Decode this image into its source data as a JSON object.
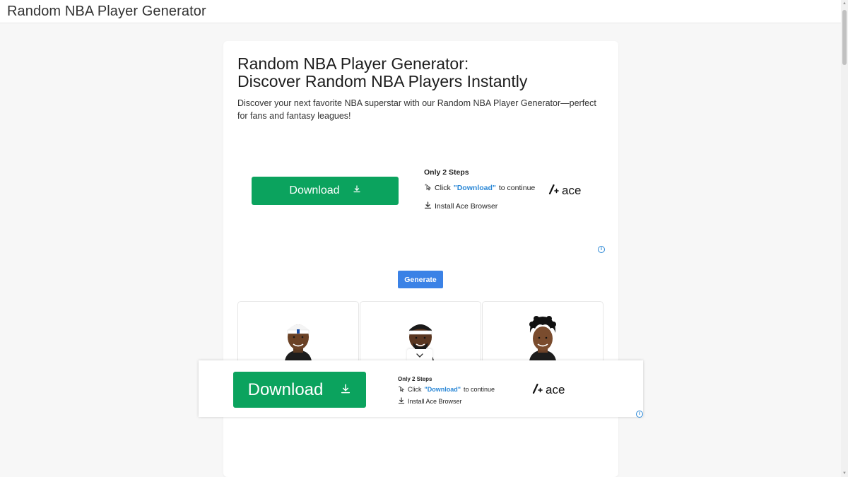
{
  "header": {
    "title": "Random NBA Player Generator"
  },
  "main": {
    "heading_line1": "Random NBA Player Generator:",
    "heading_line2": "Discover Random NBA Players Instantly",
    "intro": "Discover your next favorite NBA superstar with our Random NBA Player Generator—perfect for fans and fantasy leagues!",
    "generate_label": "Generate"
  },
  "ad": {
    "download_label": "Download",
    "steps_title": "Only 2 Steps",
    "step1_prefix": "Click",
    "step1_highlight": "\"Download\"",
    "step1_suffix": "to continue",
    "step2": "Install Ace Browser",
    "brand": "ace",
    "info_glyph": "i"
  },
  "players": [
    {
      "icon": "player-1-headshot"
    },
    {
      "icon": "player-2-headshot"
    },
    {
      "icon": "player-3-headshot"
    }
  ],
  "colors": {
    "download_green": "#0ba35e",
    "generate_blue": "#3b82e6",
    "link_blue": "#2a87d6"
  }
}
